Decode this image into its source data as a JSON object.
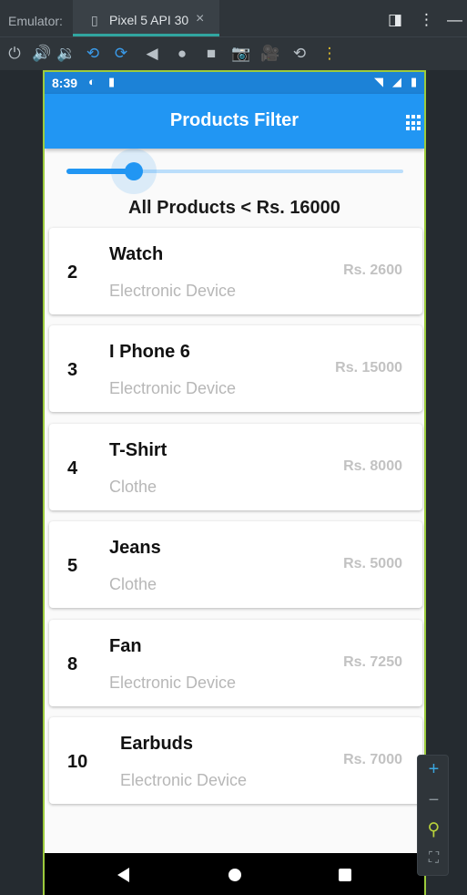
{
  "emulator": {
    "title": "Emulator:",
    "tab_label": "Pixel 5 API 30",
    "tab_close": "×",
    "toolbar_icons": [
      "power-icon",
      "volume-up-icon",
      "volume-down-icon",
      "rotate-left-icon",
      "rotate-right-icon",
      "back-icon",
      "home-icon",
      "overview-icon",
      "screenshot-icon",
      "record-icon",
      "snapshot-icon",
      "more-icon"
    ]
  },
  "status_bar": {
    "time": "8:39"
  },
  "app_bar": {
    "title": "Products Filter"
  },
  "slider": {
    "value_fraction": 0.2
  },
  "filter_label": "All Products < Rs. 16000",
  "products": [
    {
      "id": "2",
      "name": "Watch",
      "category": "Electronic Device",
      "price": "Rs. 2600"
    },
    {
      "id": "3",
      "name": "I Phone 6",
      "category": "Electronic Device",
      "price": "Rs. 15000"
    },
    {
      "id": "4",
      "name": "T-Shirt",
      "category": "Clothe",
      "price": "Rs. 8000"
    },
    {
      "id": "5",
      "name": "Jeans",
      "category": "Clothe",
      "price": "Rs. 5000"
    },
    {
      "id": "8",
      "name": "Fan",
      "category": "Electronic Device",
      "price": "Rs. 7250"
    },
    {
      "id": "10",
      "name": "Earbuds",
      "category": "Electronic Device",
      "price": "Rs. 7000"
    }
  ],
  "zoom_controls": {
    "plus": "+",
    "minus": "−"
  },
  "colors": {
    "primary": "#2196f3",
    "status_bar": "#1c82d7",
    "emulator_bg": "#252b30"
  }
}
